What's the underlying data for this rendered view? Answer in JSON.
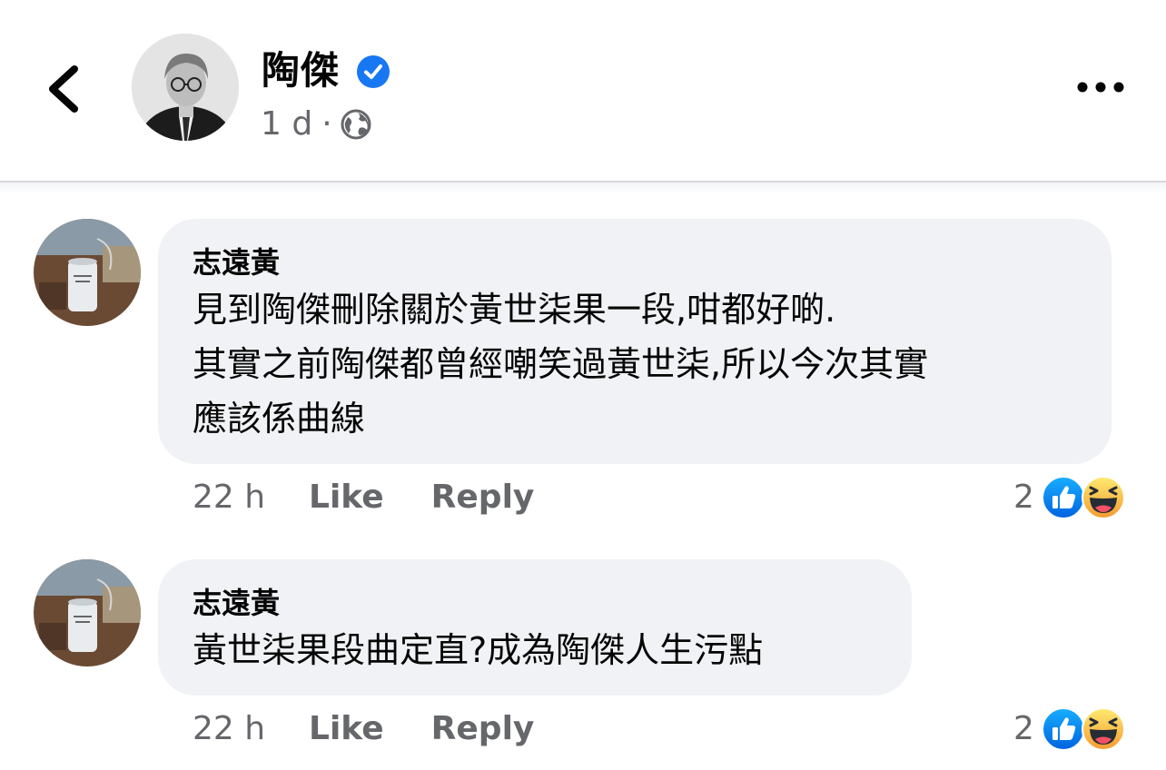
{
  "post": {
    "author_name": "陶傑",
    "age": "1 d",
    "separator": "·",
    "privacy_icon": "globe-icon",
    "verified_icon": "verified-badge-icon",
    "accent_color": "#1877f2"
  },
  "comments": [
    {
      "author": "志遠黃",
      "text": "見到陶傑刪除關於黃世柒果一段,咁都好啲.\n其實之前陶傑都曾經嘲笑過黃世柒,所以今次其實\n應該係曲線",
      "time": "22 h",
      "like_label": "Like",
      "reply_label": "Reply",
      "reaction_count": "2",
      "reactions": [
        "like-icon",
        "haha-icon"
      ]
    },
    {
      "author": "志遠黃",
      "text": "黃世柒果段曲定直?成為陶傑人生污點",
      "time": "22 h",
      "like_label": "Like",
      "reply_label": "Reply",
      "reaction_count": "2",
      "reactions": [
        "like-icon",
        "haha-icon"
      ]
    }
  ]
}
